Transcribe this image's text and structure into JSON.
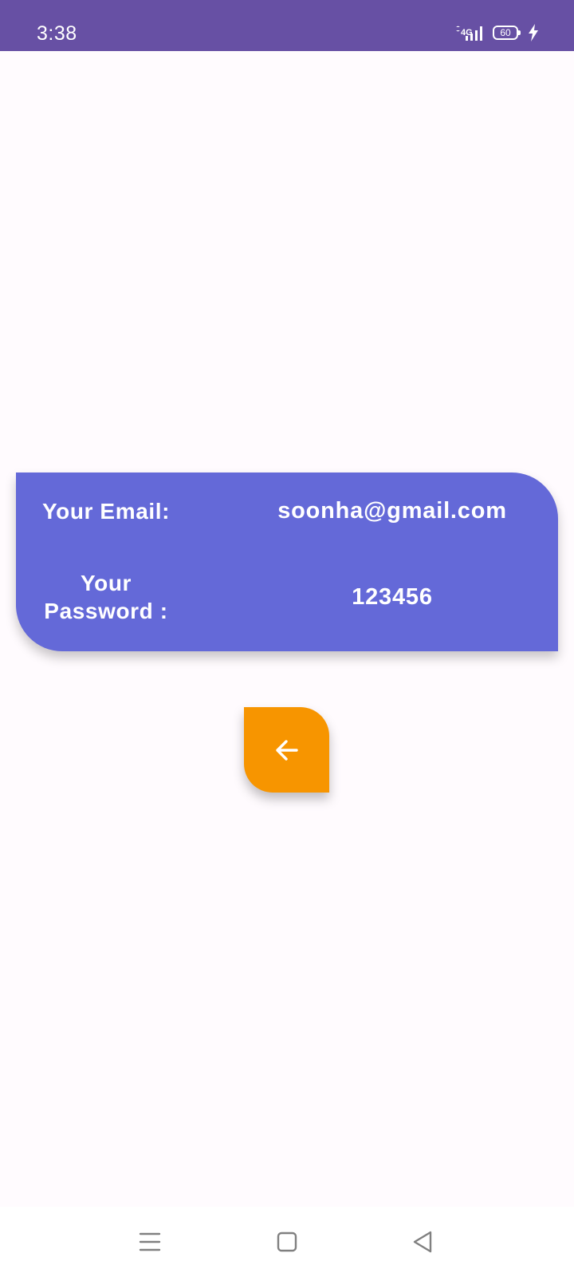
{
  "status_bar": {
    "time": "3:38",
    "network": "4G",
    "battery": "60",
    "icons": [
      "signal-icon",
      "battery-icon",
      "charging-icon"
    ]
  },
  "card": {
    "email_label": "Your Email:",
    "email_value": "soonha@gmail.com",
    "password_label_line1": "Your",
    "password_label_line2": "Password :",
    "password_value": "123456"
  },
  "fab": {
    "icon": "arrow-left-icon"
  },
  "nav_bar": {
    "icons": [
      "menu-icon",
      "home-square-icon",
      "back-triangle-icon"
    ]
  },
  "colors": {
    "status_bar": "#6750A4",
    "background": "#FFFBFE",
    "card": "#6469D8",
    "fab": "#F79500",
    "text_on_color": "#FFFFFF"
  }
}
